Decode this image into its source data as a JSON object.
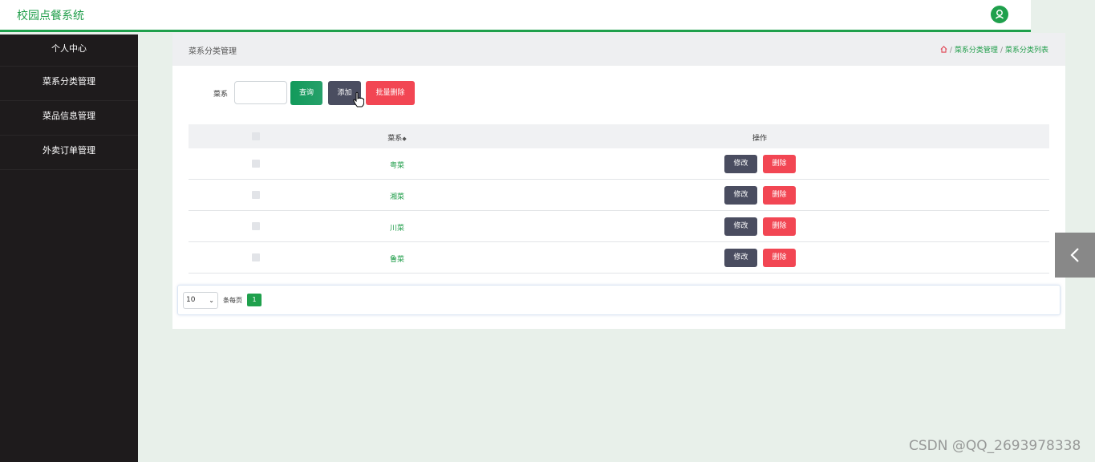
{
  "app": {
    "title": "校园点餐系统"
  },
  "sidebar": {
    "items": [
      {
        "label": "个人中心"
      },
      {
        "label": "菜系分类管理"
      },
      {
        "label": "菜品信息管理"
      },
      {
        "label": "外卖订单管理"
      }
    ]
  },
  "header": {
    "title": "菜系分类管理",
    "breadcrumb": [
      "菜系分类管理",
      "菜系分类列表"
    ]
  },
  "search": {
    "label": "菜系",
    "value": "",
    "query_label": "查询",
    "add_label": "添加",
    "bulk_delete_label": "批量删除"
  },
  "table": {
    "headers": {
      "name": "菜系",
      "sort_icon": "◆",
      "actions": "操作"
    },
    "rows": [
      {
        "name": "粤菜",
        "edit": "修改",
        "delete": "删除"
      },
      {
        "name": "湘菜",
        "edit": "修改",
        "delete": "删除"
      },
      {
        "name": "川菜",
        "edit": "修改",
        "delete": "删除"
      },
      {
        "name": "鲁菜",
        "edit": "修改",
        "delete": "删除"
      }
    ]
  },
  "pagination": {
    "page_size": "10",
    "per_page_label": "条每页",
    "current_page": "1"
  },
  "watermark": "CSDN @QQ_2693978338",
  "icons": {
    "user": "user-icon",
    "home": "home-icon",
    "cursor": "hand-cursor-icon",
    "toggle": "chevron-left-icon"
  },
  "colors": {
    "accent": "#1fa04c",
    "danger": "#f24653",
    "dark_button": "#4a4d60",
    "sidebar": "#1e1b1c"
  }
}
